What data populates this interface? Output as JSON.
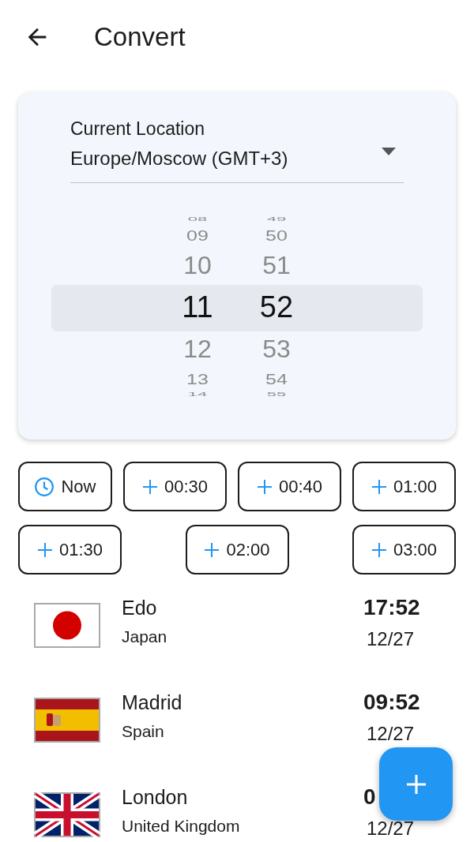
{
  "header": {
    "title": "Convert"
  },
  "location": {
    "label": "Current Location",
    "value": "Europe/Moscow (GMT+3)"
  },
  "time_picker": {
    "columns": [
      {
        "items": [
          {
            "value": "08",
            "selected": false
          },
          {
            "value": "09",
            "selected": false
          },
          {
            "value": "10",
            "selected": false
          },
          {
            "value": "11",
            "selected": true
          },
          {
            "value": "12",
            "selected": false
          },
          {
            "value": "13",
            "selected": false
          },
          {
            "value": "14",
            "selected": false
          }
        ]
      },
      {
        "items": [
          {
            "value": "49",
            "selected": false
          },
          {
            "value": "50",
            "selected": false
          },
          {
            "value": "51",
            "selected": false
          },
          {
            "value": "52",
            "selected": true
          },
          {
            "value": "53",
            "selected": false
          },
          {
            "value": "54",
            "selected": false
          },
          {
            "value": "55",
            "selected": false
          }
        ]
      }
    ]
  },
  "quick_buttons": [
    [
      {
        "kind": "now",
        "label": "Now"
      },
      {
        "kind": "add",
        "label": "00:30"
      },
      {
        "kind": "add",
        "label": "00:40"
      },
      {
        "kind": "add",
        "label": "01:00"
      }
    ],
    [
      {
        "kind": "add",
        "label": "01:30"
      },
      {
        "kind": "add",
        "label": "02:00"
      },
      {
        "kind": "add",
        "label": "03:00"
      }
    ]
  ],
  "cities": [
    {
      "kind": "japan",
      "name": "Edo",
      "country": "Japan",
      "time": "17:52",
      "date": "12/27"
    },
    {
      "kind": "spain",
      "name": "Madrid",
      "country": "Spain",
      "time": "09:52",
      "date": "12/27"
    },
    {
      "kind": "uk",
      "name": "London",
      "country": "United Kingdom",
      "time": "0",
      "date": "12/27"
    }
  ]
}
